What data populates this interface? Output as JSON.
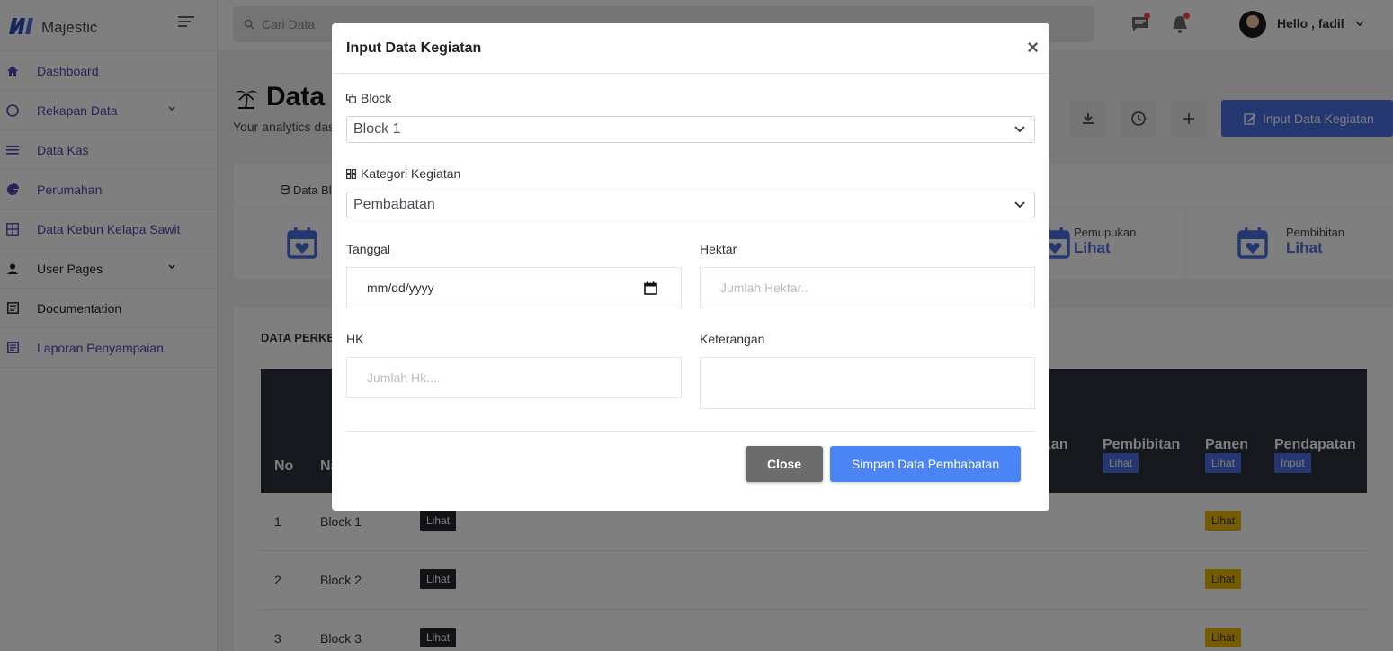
{
  "app": {
    "name": "Majestic"
  },
  "sidebar": {
    "items": [
      {
        "label": "Dashboard",
        "icon": "home-icon"
      },
      {
        "label": "Rekapan Data",
        "icon": "circle-icon",
        "has_submenu": true
      },
      {
        "label": "Data Kas",
        "icon": "list-icon"
      },
      {
        "label": "Perumahan",
        "icon": "pie-icon"
      },
      {
        "label": "Data Kebun Kelapa Sawit",
        "icon": "grid-icon"
      },
      {
        "label": "User Pages",
        "icon": "person-icon",
        "has_submenu": true
      },
      {
        "label": "Documentation",
        "icon": "document-icon"
      },
      {
        "label": "Laporan Penyampaian",
        "icon": "document-icon"
      }
    ]
  },
  "topbar": {
    "search_placeholder": "Cari Data",
    "user_greeting": "Hello , fadil"
  },
  "page": {
    "title": "Data I",
    "subtitle": "Your analytics das",
    "input_button": "Input Data Kegiatan"
  },
  "stats": {
    "tab_label": "Data Bl",
    "items": [
      {
        "label": "Pemupukan",
        "link": "Lihat"
      },
      {
        "label": "Pembibitan",
        "link": "Lihat"
      }
    ]
  },
  "table": {
    "title": "DATA PERKE",
    "headers": {
      "no": "No",
      "name": "Na",
      "pemupukan": "kan",
      "pembibitan": "Pembibitan",
      "panen": "Panen",
      "pendapatan": "Pendapatan"
    },
    "header_tags": {
      "pembibitan": "Lihat",
      "panen": "Lihat",
      "pendapatan": "Input"
    },
    "rows": [
      {
        "no": "1",
        "name": "Block 1",
        "detail": "Lihat",
        "panen": "Lihat"
      },
      {
        "no": "2",
        "name": "Block 2",
        "detail": "Lihat",
        "panen": "Lihat"
      },
      {
        "no": "3",
        "name": "Block 3",
        "detail": "Lihat",
        "panen": "Lihat"
      }
    ]
  },
  "modal": {
    "title": "Input Data Kegiatan",
    "close_symbol": "×",
    "block_label": "Block",
    "block_value": "Block 1",
    "kategori_label": "Kategori Kegiatan",
    "kategori_value": "Pembabatan",
    "tanggal_label": "Tanggal",
    "tanggal_placeholder": "mm/dd/yyyy",
    "hektar_label": "Hektar",
    "hektar_placeholder": "Jumlah Hektar..",
    "hk_label": "HK",
    "hk_placeholder": "Jumlah Hk....",
    "keterangan_label": "Keterangan",
    "close_button": "Close",
    "save_button": "Simpan Data Pembabatan"
  },
  "colors": {
    "primary": "#4b6ee0",
    "sidebar_link": "#4b49ac",
    "table_header": "#2b313b",
    "tag_yellow": "#e8b400",
    "save_button": "#4b85f5",
    "close_button": "#6c6c6c"
  }
}
